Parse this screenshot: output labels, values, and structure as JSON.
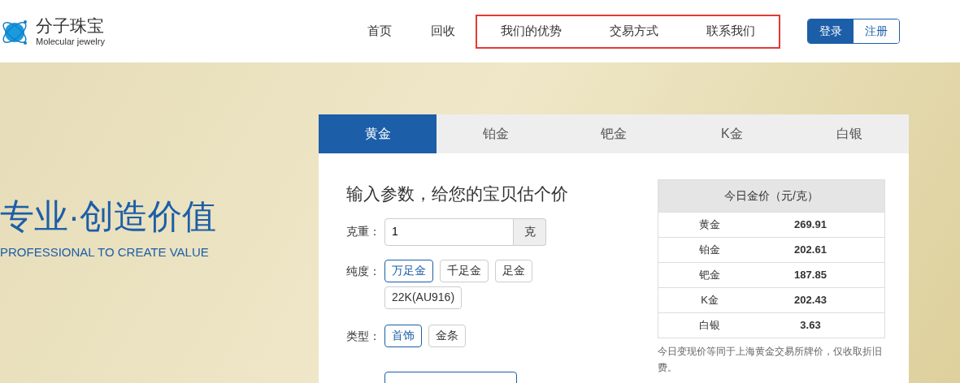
{
  "logo": {
    "name": "分子珠宝",
    "tagline": "Molecular jewelry"
  },
  "nav": [
    {
      "label": "首页"
    },
    {
      "label": "回收"
    }
  ],
  "highlight_box": {
    "links": [
      {
        "label": "我们的优势"
      },
      {
        "label": "交易方式"
      },
      {
        "label": "联系我们"
      }
    ]
  },
  "auth": [
    {
      "label": "登录",
      "selected": true
    },
    {
      "label": "注册",
      "selected": false
    }
  ],
  "hero": {
    "title": "专业·创造价值",
    "subtitle": "PROFESSIONAL TO CREATE VALUE"
  },
  "tabs": [
    {
      "label": "黄金",
      "selected": true
    },
    {
      "label": "铂金",
      "selected": false
    },
    {
      "label": "钯金",
      "selected": false
    },
    {
      "label": "K金",
      "selected": false
    },
    {
      "label": "白银",
      "selected": false
    }
  ],
  "form": {
    "heading": "输入参数，给您的宝贝估个价",
    "weight": {
      "label": "克重：",
      "value": "1",
      "unit": "克"
    },
    "purity": {
      "label": "纯度：",
      "options": [
        {
          "label": "万足金",
          "selected": true
        },
        {
          "label": "千足金",
          "selected": false
        },
        {
          "label": "足金",
          "selected": false
        },
        {
          "label": "22K(AU916)",
          "selected": false
        }
      ]
    },
    "type": {
      "label": "类型：",
      "options": [
        {
          "label": "首饰",
          "selected": true
        },
        {
          "label": "金条",
          "selected": false
        }
      ]
    }
  },
  "prices": {
    "title": "今日金价（元/克）",
    "rows": [
      {
        "metal": "黄金",
        "price": "269.91"
      },
      {
        "metal": "铂金",
        "price": "202.61"
      },
      {
        "metal": "钯金",
        "price": "187.85"
      },
      {
        "metal": "K金",
        "price": "202.43"
      },
      {
        "metal": "白银",
        "price": "3.63"
      }
    ],
    "note": "今日变现价等同于上海黄金交易所牌价，仅收取折旧费。"
  }
}
